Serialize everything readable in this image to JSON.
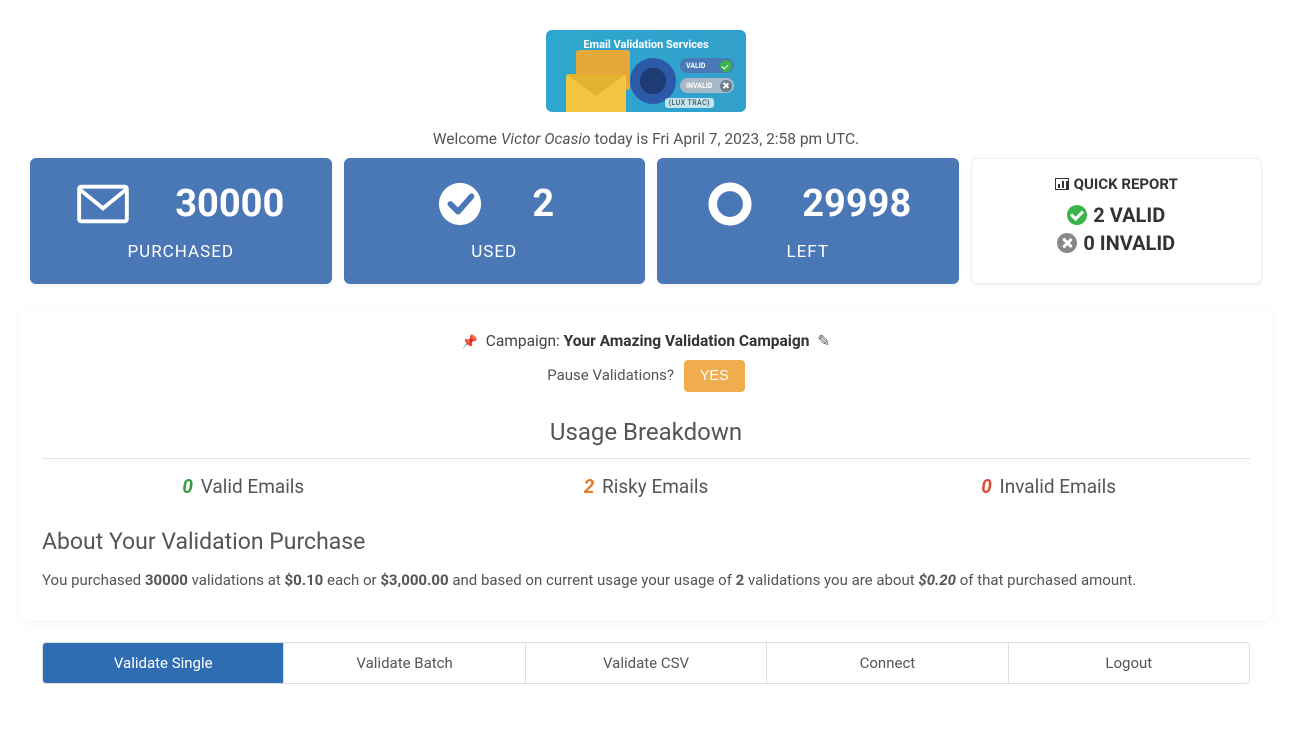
{
  "banner": {
    "title": "Email Validation Services",
    "valid_pill": "VALID",
    "invalid_pill": "INVALID",
    "logo": "{LUX TRAC}"
  },
  "welcome": {
    "prefix": "Welcome ",
    "user_name": "Victor Ocasio",
    "mid": " today is ",
    "date": "Fri April 7, 2023, 2:58 pm UTC",
    "suffix": "."
  },
  "stats": {
    "purchased": {
      "value": "30000",
      "label": "PURCHASED"
    },
    "used": {
      "value": "2",
      "label": "USED"
    },
    "left": {
      "value": "29998",
      "label": "LEFT"
    }
  },
  "quick_report": {
    "title": "QUICK REPORT",
    "valid_count": "2",
    "valid_label": "VALID",
    "invalid_count": "0",
    "invalid_label": "INVALID"
  },
  "campaign": {
    "prefix": "Campaign: ",
    "name": "Your Amazing Validation Campaign"
  },
  "pause": {
    "question": "Pause Validations?",
    "button": "YES"
  },
  "usage_breakdown": {
    "title": "Usage Breakdown",
    "valid": {
      "count": "0",
      "label": "Valid Emails"
    },
    "risky": {
      "count": "2",
      "label": "Risky Emails"
    },
    "invalid": {
      "count": "0",
      "label": "Invalid Emails"
    }
  },
  "about": {
    "title": "About Your Validation Purchase",
    "p1": "You purchased ",
    "qty": "30000",
    "p2": " validations at ",
    "rate": "$0.10",
    "p3": " each or ",
    "total": "$3,000.00",
    "p4": " and based on current usage your usage of ",
    "used": "2",
    "p5": " validations you are about ",
    "amount": "$0.20",
    "p6": " of that purchased amount."
  },
  "tabs": {
    "validate_single": "Validate Single",
    "validate_batch": "Validate Batch",
    "validate_csv": "Validate CSV",
    "connect": "Connect",
    "logout": "Logout"
  }
}
